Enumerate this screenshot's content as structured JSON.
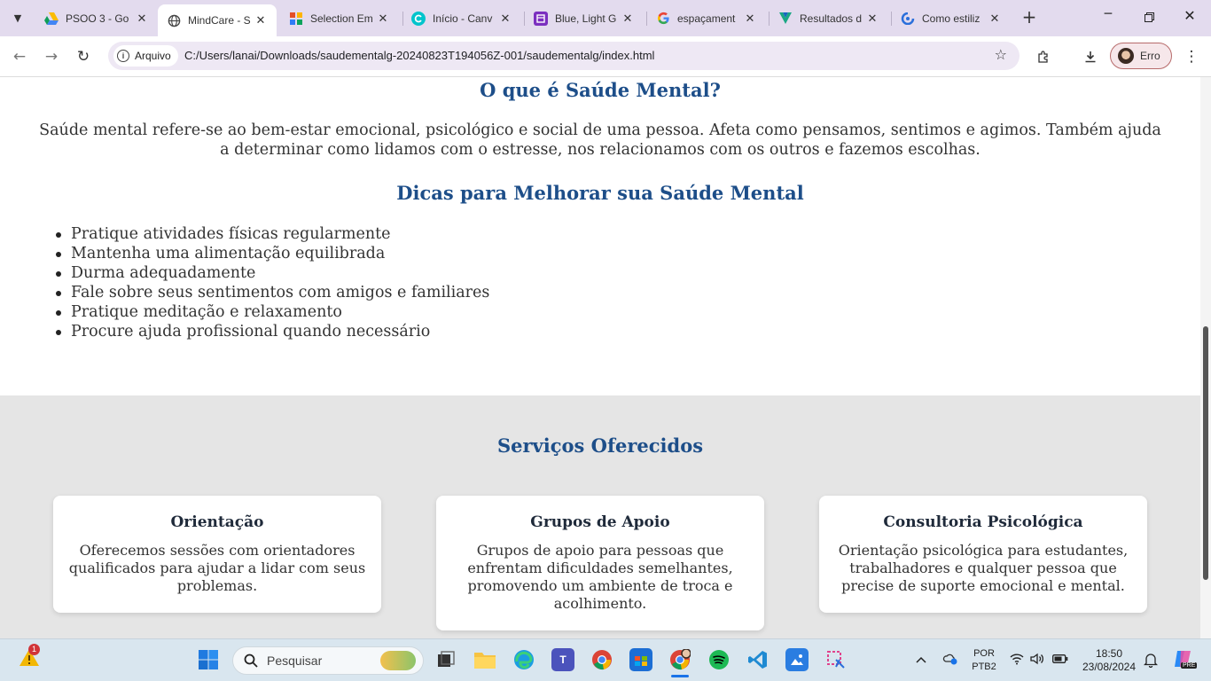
{
  "browser": {
    "tabs": [
      {
        "title": "PSOO 3 - Go",
        "favicon": "google-drive-icon",
        "color": "#1a73e8"
      },
      {
        "title": "MindCare - S",
        "favicon": "globe-icon",
        "active": true
      },
      {
        "title": "Selection Em",
        "favicon": "figma-icon",
        "color": "#e44d26"
      },
      {
        "title": "Início - Canv",
        "favicon": "canva-icon",
        "color": "#00c4cc"
      },
      {
        "title": "Blue, Light G",
        "favicon": "palette-icon",
        "color": "#7b2fbf"
      },
      {
        "title": "espaçament",
        "favicon": "google-icon",
        "color": "#4285f4"
      },
      {
        "title": "Resultados d",
        "favicon": "vuetify-icon",
        "color": "#1aa784"
      },
      {
        "title": "Como estiliz",
        "favicon": "copilot-icon",
        "color": "#2a6fdb"
      }
    ],
    "new_tab": "+",
    "address": {
      "chip_label": "Arquivo",
      "url": "C:/Users/lanai/Downloads/saudementalg-20240823T194056Z-001/saudementalg/index.html"
    },
    "profile_label": "Erro"
  },
  "page": {
    "about_title": "O que é Saúde Mental?",
    "about_text": "Saúde mental refere-se ao bem-estar emocional, psicológico e social de uma pessoa. Afeta como pensamos, sentimos e agimos. Também ajuda a determinar como lidamos com o estresse, nos relacionamos com os outros e fazemos escolhas.",
    "tips_title": "Dicas para Melhorar sua Saúde Mental",
    "tips": [
      "Pratique atividades físicas regularmente",
      "Mantenha uma alimentação equilibrada",
      "Durma adequadamente",
      "Fale sobre seus sentimentos com amigos e familiares",
      "Pratique meditação e relaxamento",
      "Procure ajuda profissional quando necessário"
    ],
    "services_title": "Serviços Oferecidos",
    "services": [
      {
        "title": "Orientação",
        "text": "Oferecemos sessões com orientadores qualificados para ajudar a lidar com seus problemas."
      },
      {
        "title": "Grupos de Apoio",
        "text": "Grupos de apoio para pessoas que enfrentam dificuldades semelhantes, promovendo um ambiente de troca e acolhimento."
      },
      {
        "title": "Consultoria Psicológica",
        "text": "Orientação psicológica para estudantes, trabalhadores e qualquer pessoa que precise de suporte emocional e mental."
      }
    ],
    "accent_color": "#1d4e89"
  },
  "taskbar": {
    "weather_badge": "1",
    "search_placeholder": "Pesquisar",
    "language": "POR",
    "layout": "PTB2",
    "time": "18:50",
    "date": "23/08/2024",
    "copilot_badge": "PRE"
  }
}
